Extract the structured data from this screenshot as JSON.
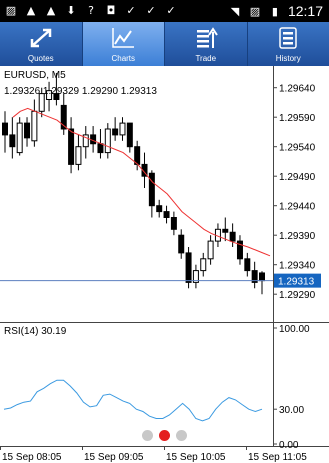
{
  "status_bar": {
    "time": "12:17",
    "left_icons": [
      "gallery-icon",
      "app-icon",
      "app-icon",
      "download-icon",
      "question-icon",
      "bag-icon",
      "check-icon",
      "check-icon",
      "check-icon"
    ],
    "right_icons": [
      "wifi-icon",
      "no-sim-icon",
      "battery-icon"
    ]
  },
  "toolbar": {
    "tabs": [
      {
        "label": "Quotes",
        "icon": "quotes-arrows-icon",
        "active": false
      },
      {
        "label": "Charts",
        "icon": "chart-line-icon",
        "active": true
      },
      {
        "label": "Trade",
        "icon": "trade-icon",
        "active": false
      },
      {
        "label": "History",
        "icon": "history-icon",
        "active": false
      }
    ]
  },
  "chart": {
    "symbol": "EURUSD, M5",
    "ohlc": "1.29326 1.29329 1.29290 1.29313",
    "current_price": "1.29313",
    "price_ticks": [
      "1.29640",
      "1.29590",
      "1.29540",
      "1.29490",
      "1.29440",
      "1.29390",
      "1.29340",
      "1.29290"
    ],
    "rsi_label": "RSI(14) 30.19",
    "rsi_ticks": [
      "100.00",
      "30.00",
      "0.00"
    ],
    "time_ticks": [
      "15 Sep 08:05",
      "15 Sep 09:05",
      "15 Sep 10:05",
      "15 Sep 11:05"
    ],
    "colors": {
      "ma": "#e33",
      "rsi": "#3b9ae1",
      "price_line": "#5b7fbf",
      "axis": "#444",
      "current_box": "#1565c0"
    }
  },
  "chart_data": {
    "type": "candlestick",
    "price_range": [
      1.2927,
      1.2967
    ],
    "ohlc_series": [
      [
        1.2958,
        1.296,
        1.2953,
        1.2956
      ],
      [
        1.2956,
        1.2959,
        1.2952,
        1.2954
      ],
      [
        1.2953,
        1.2959,
        1.29525,
        1.2958
      ],
      [
        1.2958,
        1.2959,
        1.2954,
        1.29555
      ],
      [
        1.2955,
        1.2962,
        1.2954,
        1.296
      ],
      [
        1.296,
        1.2964,
        1.2959,
        1.2963
      ],
      [
        1.2962,
        1.2965,
        1.296,
        1.29635
      ],
      [
        1.2963,
        1.29665,
        1.2961,
        1.2962
      ],
      [
        1.2961,
        1.2963,
        1.2956,
        1.2957
      ],
      [
        1.2957,
        1.2959,
        1.29495,
        1.2951
      ],
      [
        1.2951,
        1.2956,
        1.295,
        1.2954
      ],
      [
        1.2954,
        1.29575,
        1.2952,
        1.2956
      ],
      [
        1.2956,
        1.29575,
        1.2953,
        1.29545
      ],
      [
        1.29545,
        1.2957,
        1.2952,
        1.2953
      ],
      [
        1.2953,
        1.2958,
        1.2952,
        1.2957
      ],
      [
        1.2957,
        1.2959,
        1.2955,
        1.2956
      ],
      [
        1.2956,
        1.2959,
        1.2955,
        1.2958
      ],
      [
        1.2958,
        1.2958,
        1.2953,
        1.2954
      ],
      [
        1.2954,
        1.2955,
        1.295,
        1.2951
      ],
      [
        1.2951,
        1.2953,
        1.2947,
        1.2949
      ],
      [
        1.29495,
        1.295,
        1.2942,
        1.2944
      ],
      [
        1.2944,
        1.2945,
        1.2942,
        1.2943
      ],
      [
        1.2943,
        1.2944,
        1.2941,
        1.2942
      ],
      [
        1.2942,
        1.2943,
        1.2939,
        1.294
      ],
      [
        1.2939,
        1.294,
        1.2935,
        1.2936
      ],
      [
        1.2936,
        1.2937,
        1.293,
        1.2931
      ],
      [
        1.2931,
        1.2934,
        1.293,
        1.2933
      ],
      [
        1.2933,
        1.2936,
        1.2932,
        1.2935
      ],
      [
        1.2935,
        1.2939,
        1.2934,
        1.2938
      ],
      [
        1.2938,
        1.2941,
        1.2937,
        1.294
      ],
      [
        1.294,
        1.2942,
        1.2938,
        1.29395
      ],
      [
        1.29395,
        1.2941,
        1.2937,
        1.2938
      ],
      [
        1.2938,
        1.2939,
        1.2934,
        1.2935
      ],
      [
        1.2935,
        1.2936,
        1.2932,
        1.2933
      ],
      [
        1.2933,
        1.29345,
        1.293,
        1.2931
      ],
      [
        1.29326,
        1.29329,
        1.2929,
        1.29313
      ]
    ],
    "ma_series": [
      1.2959,
      1.296,
      1.29605,
      1.296,
      1.29595,
      1.2959,
      1.29585,
      1.29575,
      1.29565,
      1.2956,
      1.29555,
      1.2955,
      1.29545,
      1.2954,
      1.29535,
      1.2953,
      1.2952,
      1.2951,
      1.29495,
      1.2948,
      1.2947,
      1.2946,
      1.29445,
      1.2943,
      1.2942,
      1.2941,
      1.294,
      1.29393,
      1.29388,
      1.29383,
      1.29378,
      1.29374,
      1.2937,
      1.29365,
      1.2936,
      1.29355
    ],
    "rsi_range": [
      0,
      100
    ],
    "rsi_series": [
      30,
      31,
      34,
      36,
      37,
      45,
      48,
      52,
      55,
      55,
      50,
      44,
      36,
      32,
      33,
      42,
      43,
      40,
      37,
      35,
      30,
      28,
      24,
      22,
      22,
      25,
      30,
      35,
      30,
      22,
      20,
      22,
      30,
      36,
      40,
      38,
      34,
      30,
      28,
      30
    ]
  }
}
